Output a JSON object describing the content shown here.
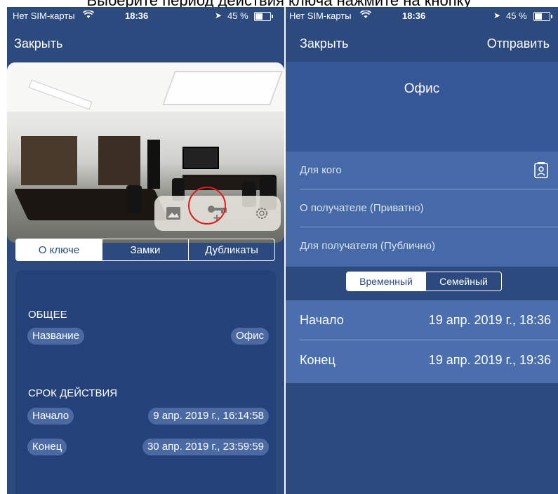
{
  "caption": "Выберите период действия ключа нажмите на кнопку",
  "left": {
    "status": {
      "carrier": "Нет SIM-карты",
      "time": "18:36",
      "battery": "45 %"
    },
    "close_label": "Закрыть",
    "tabs": [
      {
        "label": "О ключе",
        "active": true
      },
      {
        "label": "Замки",
        "active": false
      },
      {
        "label": "Дубликаты",
        "active": false
      }
    ],
    "general": {
      "section": "ОБЩЕЕ",
      "name_label": "Название",
      "name_value": "Офис"
    },
    "validity": {
      "section": "СРОК ДЕЙСТВИЯ",
      "start_label": "Начало",
      "start_value": "9 апр. 2019 г., 16:14:58",
      "end_label": "Конец",
      "end_value": "30 апр. 2019 г., 23:59:59"
    }
  },
  "right": {
    "status": {
      "carrier": "Нет SIM-карты",
      "time": "18:36",
      "battery": "45 %"
    },
    "close_label": "Закрыть",
    "send_label": "Отправить",
    "key_name": "Офис",
    "fields": {
      "for_whom": "Для кого",
      "about_recipient": "О получателе (Приватно)",
      "for_recipient": "Для получателя (Публично)"
    },
    "type_tabs": [
      {
        "label": "Временный",
        "active": true
      },
      {
        "label": "Семейный",
        "active": false
      }
    ],
    "start_label": "Начало",
    "start_value": "19 апр. 2019 г., 18:36",
    "end_label": "Конец",
    "end_value": "19 апр. 2019 г., 19:36"
  },
  "icons": {
    "photo": "image-icon",
    "add_key": "key-plus-icon",
    "settings": "gear-icon",
    "contact": "contact-card-icon"
  },
  "colors": {
    "background": "#2c4a7e",
    "card": "#25417a",
    "field_bg": "#466aa8",
    "highlight": "#e11b1b"
  }
}
